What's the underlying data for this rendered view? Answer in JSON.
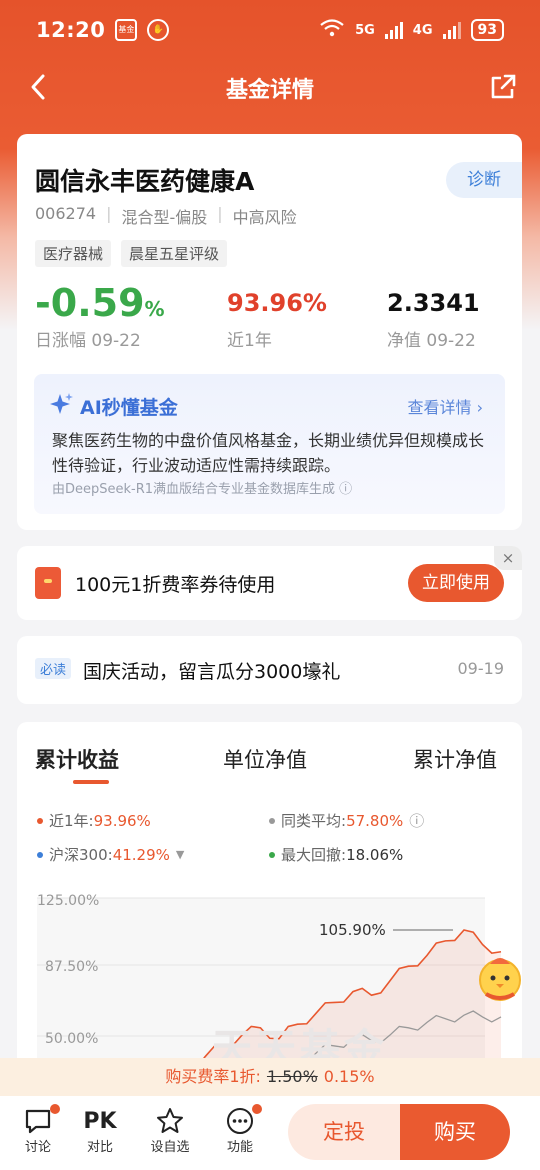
{
  "status_bar": {
    "time": "12:20",
    "app_icon_label": "基金",
    "network_1": "6",
    "network_2": "5G",
    "network_3": "4G",
    "battery": "93"
  },
  "nav": {
    "title": "基金详情"
  },
  "fund": {
    "name": "圆信永丰医药健康A",
    "diagnose_label": "诊断",
    "code": "006274",
    "type": "混合型-偏股",
    "risk": "中高风险",
    "tags": [
      "医疗器械",
      "晨星五星评级"
    ],
    "daily_change": "-0.59",
    "daily_change_unit": "%",
    "daily_change_label": "日涨幅 09-22",
    "year_return": "93.96%",
    "year_return_label": "近1年",
    "nav_value": "2.3341",
    "nav_label": "净值 09-22"
  },
  "ai": {
    "title": "AI秒懂基金",
    "link": "查看详情",
    "description": "聚焦医药生物的中盘价值风格基金，长期业绩优异但规模成长性待验证，行业波动适应性需持续跟踪。",
    "source": "由DeepSeek-R1满血版结合专业基金数据库生成"
  },
  "coupon": {
    "text": "100元1折费率券待使用",
    "button": "立即使用",
    "close": "×"
  },
  "notice": {
    "badge": "必读",
    "text": "国庆活动，留言瓜分3000壕礼",
    "date": "09-19"
  },
  "chart_tabs": [
    "累计收益",
    "单位净值",
    "累计净值"
  ],
  "legend": {
    "fund": {
      "key": "近1年:",
      "value": "93.96%",
      "color": "#e8582f"
    },
    "peer": {
      "key": "同类平均:",
      "value": "57.80%",
      "color": "#999999"
    },
    "index": {
      "key": "沪深300:",
      "value": "41.29%",
      "color": "#3d7fd8"
    },
    "drawdown": {
      "key": "最大回撤:",
      "value": "18.06%",
      "color": "#3aa84a"
    }
  },
  "chart_data": {
    "type": "line",
    "y_ticks": [
      "125.00%",
      "87.50%",
      "50.00%"
    ],
    "ylim": [
      50,
      125
    ],
    "peak_label": "105.90%",
    "watermark": "天天基金",
    "series": [
      {
        "name": "近1年",
        "color": "#e8582f",
        "values": [
          0,
          8,
          14,
          12,
          20,
          26,
          30,
          28,
          36,
          42,
          48,
          52,
          46,
          54,
          60,
          66,
          72,
          70,
          78,
          86,
          92,
          100,
          106,
          98,
          94
        ]
      },
      {
        "name": "同类平均",
        "color": "#999999",
        "values": [
          0,
          5,
          9,
          8,
          12,
          16,
          18,
          18,
          22,
          26,
          30,
          33,
          30,
          34,
          38,
          42,
          46,
          45,
          48,
          52,
          55,
          57,
          59,
          58,
          58
        ]
      }
    ]
  },
  "fee_banner": {
    "prefix": "购买费率1折:",
    "old_rate": "1.50%",
    "new_rate": "0.15%"
  },
  "bottom": {
    "discuss": "讨论",
    "compare_icon": "PK",
    "compare": "对比",
    "watchlist": "设自选",
    "functions": "功能",
    "plan": "定投",
    "buy": "购买"
  }
}
